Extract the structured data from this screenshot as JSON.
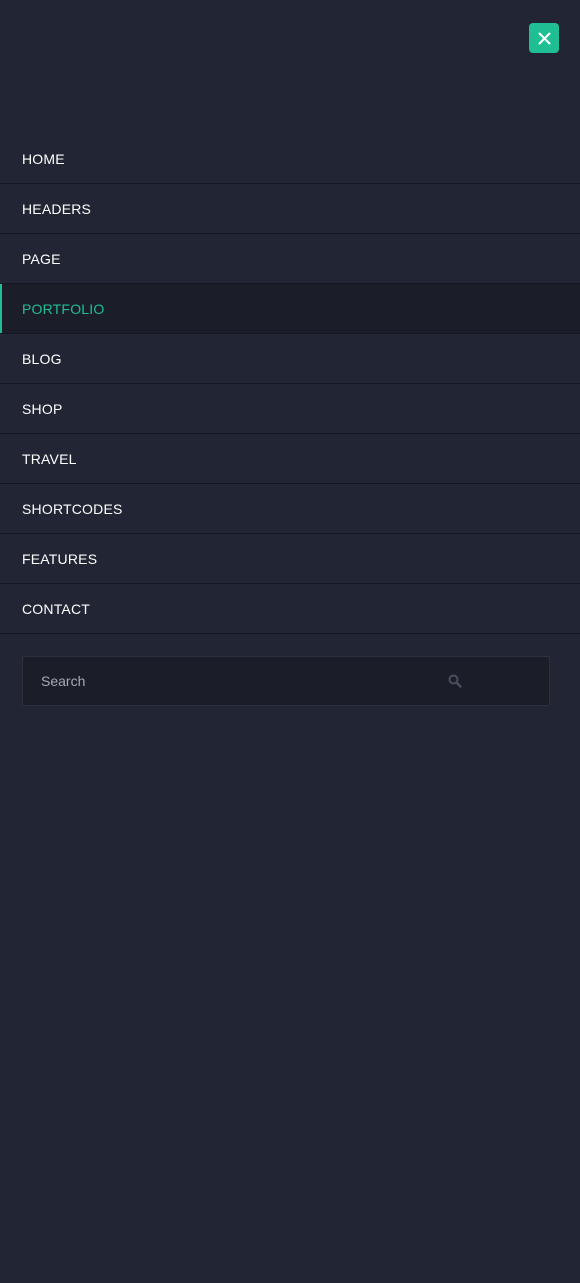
{
  "menu": {
    "close_icon": "close-icon",
    "items": [
      {
        "label": "HOME",
        "active": false
      },
      {
        "label": "HEADERS",
        "active": false
      },
      {
        "label": "PAGE",
        "active": false
      },
      {
        "label": "PORTFOLIO",
        "active": true
      },
      {
        "label": "BLOG",
        "active": false
      },
      {
        "label": "SHOP",
        "active": false
      },
      {
        "label": "TRAVEL",
        "active": false
      },
      {
        "label": "SHORTCODES",
        "active": false
      },
      {
        "label": "FEATURES",
        "active": false
      },
      {
        "label": "CONTACT",
        "active": false
      }
    ]
  },
  "search": {
    "placeholder": "Search",
    "value": "",
    "icon": "search-icon"
  },
  "colors": {
    "background": "#222634",
    "accent": "#1fbf93",
    "active_bg": "#1b1e29",
    "divider": "#151821",
    "text": "#ffffff"
  }
}
